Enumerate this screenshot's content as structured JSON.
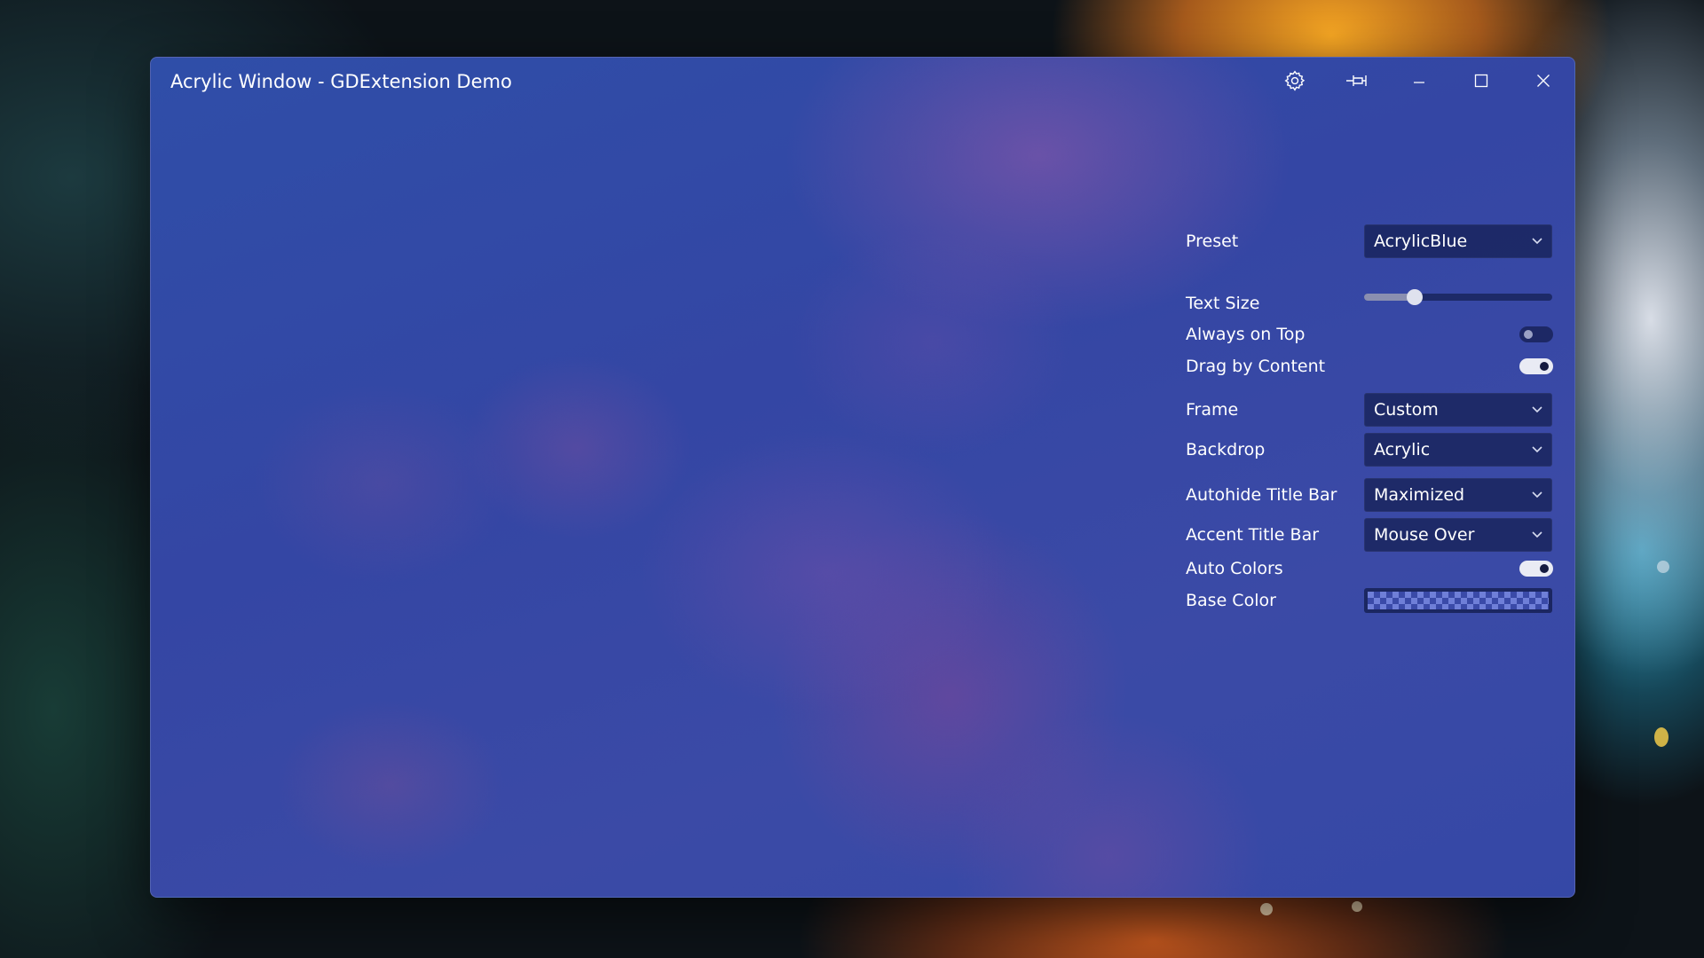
{
  "window": {
    "title": "Acrylic Window - GDExtension Demo",
    "controls": [
      "gear-icon",
      "pin-icon",
      "minimize-icon",
      "maximize-icon",
      "close-icon"
    ]
  },
  "settings": {
    "preset": {
      "label": "Preset",
      "value": "AcrylicBlue"
    },
    "text_size": {
      "label": "Text Size",
      "value_fraction": 0.27
    },
    "always_on_top": {
      "label": "Always on Top",
      "enabled": false
    },
    "drag_by_content": {
      "label": "Drag by Content",
      "enabled": true
    },
    "frame": {
      "label": "Frame",
      "value": "Custom"
    },
    "backdrop": {
      "label": "Backdrop",
      "value": "Acrylic"
    },
    "autohide_title_bar": {
      "label": "Autohide Title Bar",
      "value": "Maximized"
    },
    "accent_title_bar": {
      "label": "Accent Title Bar",
      "value": "Mouse Over"
    },
    "auto_colors": {
      "label": "Auto Colors",
      "enabled": true
    },
    "base_color": {
      "label": "Base Color",
      "color": "#6f7fd8"
    }
  },
  "colors": {
    "window_bg": "#3446a4",
    "control_bg": "#141e50",
    "text": "#ffffff"
  }
}
